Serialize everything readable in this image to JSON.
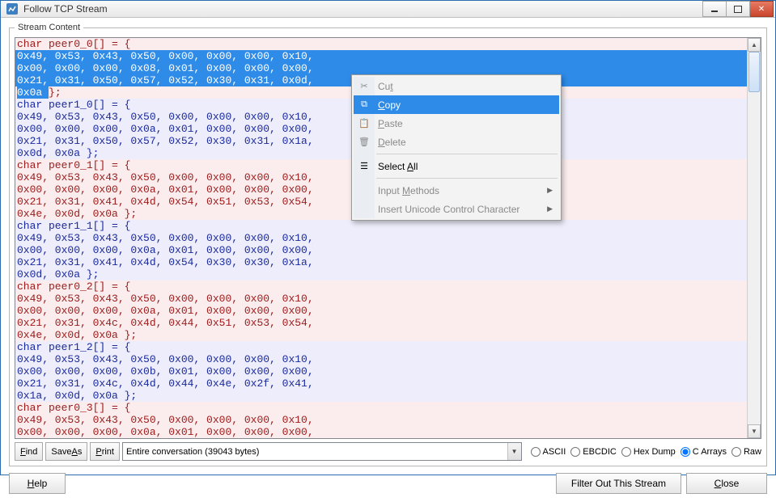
{
  "window": {
    "title": "Follow TCP Stream"
  },
  "fieldset": {
    "legend": "Stream Content"
  },
  "content": {
    "lines": [
      {
        "cls": "red",
        "hl": false,
        "text": "char peer0_0[] = {"
      },
      {
        "cls": "red",
        "hl": true,
        "text": "0x49, 0x53, 0x43, 0x50, 0x00, 0x00, 0x00, 0x10, "
      },
      {
        "cls": "red",
        "hl": true,
        "text": "0x00, 0x00, 0x00, 0x08, 0x01, 0x00, 0x00, 0x00, "
      },
      {
        "cls": "red",
        "hl": true,
        "text": "0x21, 0x31, 0x50, 0x57, 0x52, 0x30, 0x31, 0x0d, "
      },
      {
        "cls": "red",
        "hl": true,
        "textPrefix": "0x0a ",
        "textSuffix": "};"
      },
      {
        "cls": "blue",
        "hl": false,
        "text": "char peer1_0[] = {"
      },
      {
        "cls": "blue",
        "hl": false,
        "text": "0x49, 0x53, 0x43, 0x50, 0x00, 0x00, 0x00, 0x10, "
      },
      {
        "cls": "blue",
        "hl": false,
        "text": "0x00, 0x00, 0x00, 0x0a, 0x01, 0x00, 0x00, 0x00, "
      },
      {
        "cls": "blue",
        "hl": false,
        "text": "0x21, 0x31, 0x50, 0x57, 0x52, 0x30, 0x31, 0x1a, "
      },
      {
        "cls": "blue",
        "hl": false,
        "text": "0x0d, 0x0a };"
      },
      {
        "cls": "red",
        "hl": false,
        "text": "char peer0_1[] = {"
      },
      {
        "cls": "red",
        "hl": false,
        "text": "0x49, 0x53, 0x43, 0x50, 0x00, 0x00, 0x00, 0x10, "
      },
      {
        "cls": "red",
        "hl": false,
        "text": "0x00, 0x00, 0x00, 0x0a, 0x01, 0x00, 0x00, 0x00, "
      },
      {
        "cls": "red",
        "hl": false,
        "text": "0x21, 0x31, 0x41, 0x4d, 0x54, 0x51, 0x53, 0x54, "
      },
      {
        "cls": "red",
        "hl": false,
        "text": "0x4e, 0x0d, 0x0a };"
      },
      {
        "cls": "blue",
        "hl": false,
        "text": "char peer1_1[] = {"
      },
      {
        "cls": "blue",
        "hl": false,
        "text": "0x49, 0x53, 0x43, 0x50, 0x00, 0x00, 0x00, 0x10, "
      },
      {
        "cls": "blue",
        "hl": false,
        "text": "0x00, 0x00, 0x00, 0x0a, 0x01, 0x00, 0x00, 0x00, "
      },
      {
        "cls": "blue",
        "hl": false,
        "text": "0x21, 0x31, 0x41, 0x4d, 0x54, 0x30, 0x30, 0x1a, "
      },
      {
        "cls": "blue",
        "hl": false,
        "text": "0x0d, 0x0a };"
      },
      {
        "cls": "red",
        "hl": false,
        "text": "char peer0_2[] = {"
      },
      {
        "cls": "red",
        "hl": false,
        "text": "0x49, 0x53, 0x43, 0x50, 0x00, 0x00, 0x00, 0x10, "
      },
      {
        "cls": "red",
        "hl": false,
        "text": "0x00, 0x00, 0x00, 0x0a, 0x01, 0x00, 0x00, 0x00, "
      },
      {
        "cls": "red",
        "hl": false,
        "text": "0x21, 0x31, 0x4c, 0x4d, 0x44, 0x51, 0x53, 0x54, "
      },
      {
        "cls": "red",
        "hl": false,
        "text": "0x4e, 0x0d, 0x0a };"
      },
      {
        "cls": "blue",
        "hl": false,
        "text": "char peer1_2[] = {"
      },
      {
        "cls": "blue",
        "hl": false,
        "text": "0x49, 0x53, 0x43, 0x50, 0x00, 0x00, 0x00, 0x10, "
      },
      {
        "cls": "blue",
        "hl": false,
        "text": "0x00, 0x00, 0x00, 0x0b, 0x01, 0x00, 0x00, 0x00, "
      },
      {
        "cls": "blue",
        "hl": false,
        "text": "0x21, 0x31, 0x4c, 0x4d, 0x44, 0x4e, 0x2f, 0x41, "
      },
      {
        "cls": "blue",
        "hl": false,
        "text": "0x1a, 0x0d, 0x0a };"
      },
      {
        "cls": "red",
        "hl": false,
        "text": "char peer0_3[] = {"
      },
      {
        "cls": "red",
        "hl": false,
        "text": "0x49, 0x53, 0x43, 0x50, 0x00, 0x00, 0x00, 0x10, "
      },
      {
        "cls": "red",
        "hl": false,
        "text": "0x00, 0x00, 0x00, 0x0a, 0x01, 0x00, 0x00, 0x00, "
      }
    ]
  },
  "toolbar": {
    "find": "Find",
    "find_u": "F",
    "saveas_pre": "Save ",
    "saveas_u": "A",
    "saveas_post": "s",
    "print": "Print",
    "print_u": "P",
    "combo": "Entire conversation (39043 bytes)"
  },
  "radios": {
    "ascii": "ASCII",
    "ebcdic": "EBCDIC",
    "hexdump": "Hex Dump",
    "carrays": "C Arrays",
    "raw": "Raw",
    "selected": "carrays"
  },
  "buttons": {
    "help": "Help",
    "filter": "Filter Out This Stream",
    "close": "Close"
  },
  "ctx": {
    "cut": "Cut",
    "copy": "Copy",
    "paste": "Paste",
    "delete": "Delete",
    "selectall": "Select All",
    "inputmethods": "Input Methods",
    "insertunicode": "Insert Unicode Control Character"
  }
}
